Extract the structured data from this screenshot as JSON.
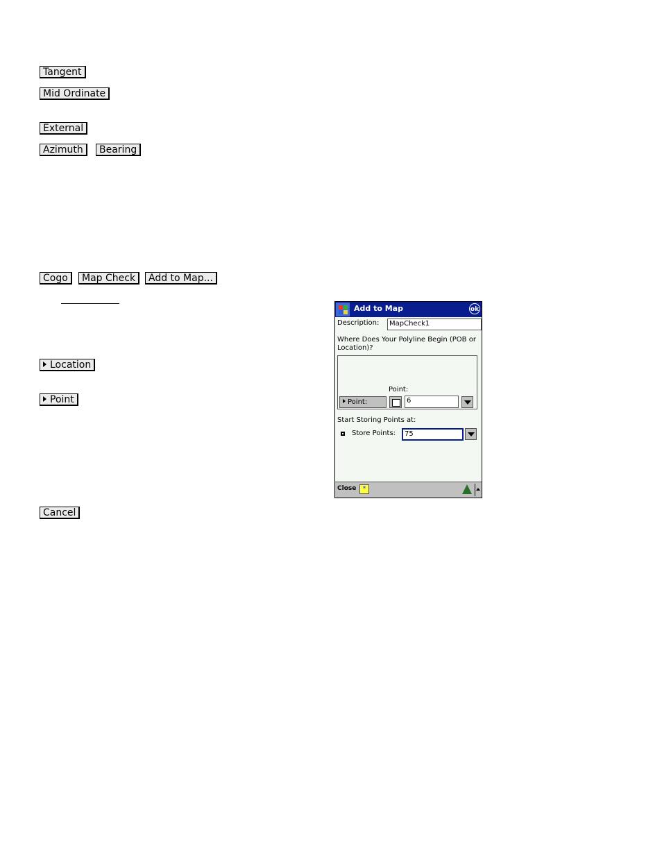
{
  "doc_buttons": {
    "tangent": "Tangent",
    "mid_ordinate": "Mid Ordinate",
    "external": "External",
    "azimuth": "Azimuth",
    "bearing": "Bearing",
    "cogo": "Cogo",
    "map_check": "Map Check",
    "add_to_map": "Add to Map...",
    "location": "Location",
    "point": "Point",
    "cancel": "Cancel"
  },
  "dialog": {
    "title": "Add to Map",
    "ok_label": "ok",
    "description_label": "Description:",
    "description_value": "MapCheck1",
    "question": "Where Does Your Polyline Begin (POB or Location)?",
    "point_caption": "Point:",
    "point_button": "Point:",
    "point_value": "6",
    "start_storing_label": "Start Storing Points at:",
    "store_points_label": "Store Points:",
    "store_points_value": "75",
    "close_label": "Close",
    "sip_icon": "star-icon",
    "accent_color": "#0a1d8e"
  }
}
